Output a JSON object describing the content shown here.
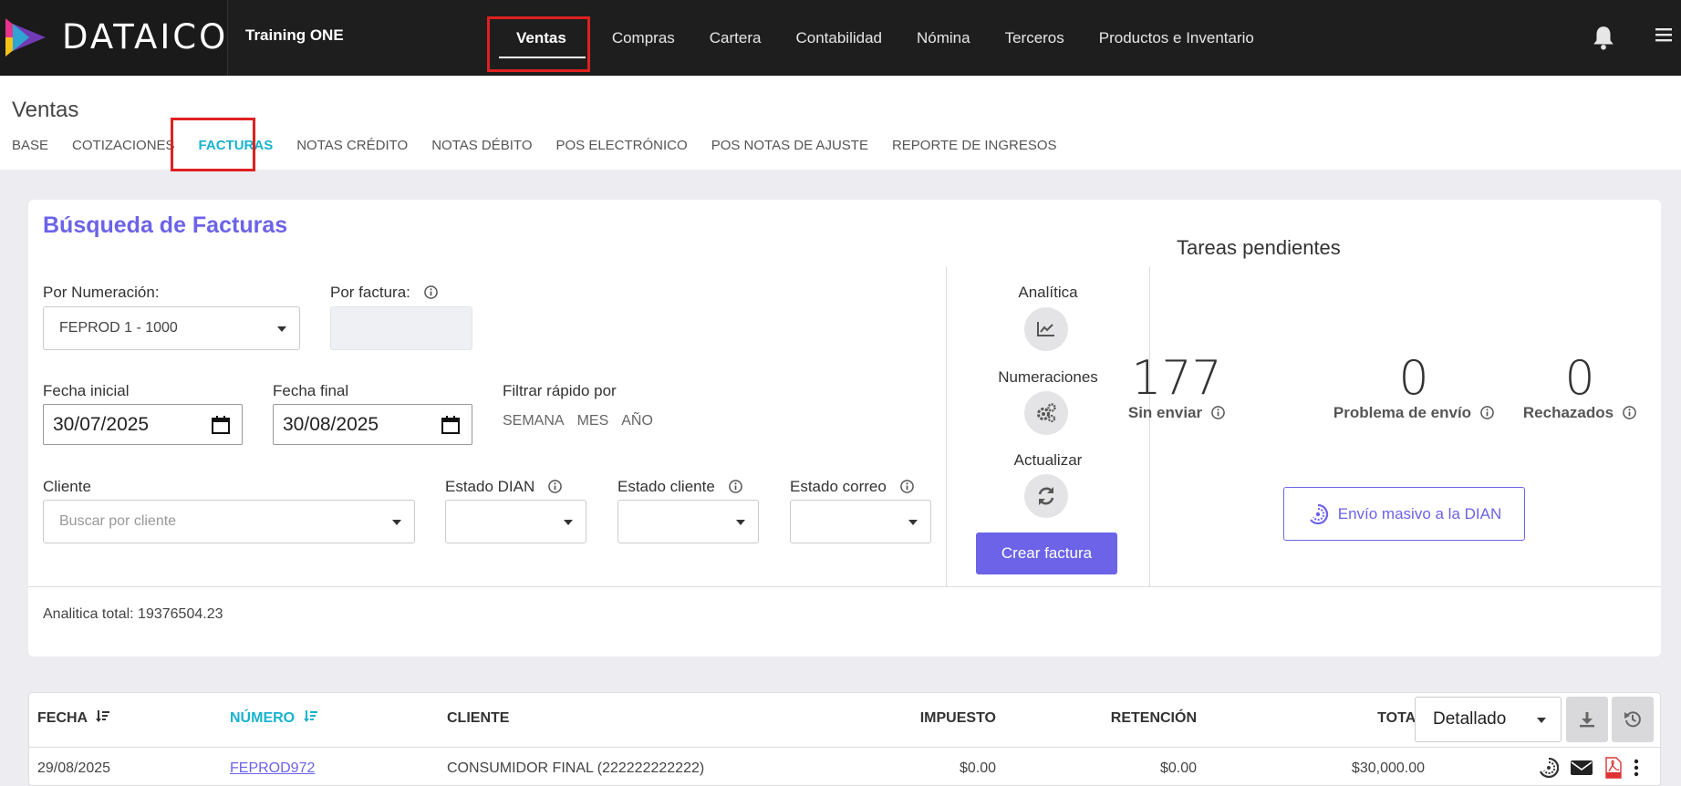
{
  "brand": {
    "name": "DATAICO",
    "company": "Training ONE"
  },
  "mainnav": {
    "items": [
      {
        "label": "Ventas",
        "active": true
      },
      {
        "label": "Compras"
      },
      {
        "label": "Cartera"
      },
      {
        "label": "Contabilidad"
      },
      {
        "label": "Nómina"
      },
      {
        "label": "Terceros"
      },
      {
        "label": "Productos e Inventario"
      }
    ]
  },
  "page": {
    "title": "Ventas",
    "subnav": [
      {
        "label": "BASE"
      },
      {
        "label": "COTIZACIONES"
      },
      {
        "label": "FACTURAS",
        "active": true
      },
      {
        "label": "NOTAS CRÉDITO"
      },
      {
        "label": "NOTAS DÉBITO"
      },
      {
        "label": "POS ELECTRÓNICO"
      },
      {
        "label": "POS NOTAS DE AJUSTE"
      },
      {
        "label": "REPORTE DE INGRESOS"
      }
    ]
  },
  "search": {
    "title": "Búsqueda de Facturas",
    "numeracion_label": "Por Numeración:",
    "numeracion_value": "FEPROD 1 - 1000",
    "factura_label": "Por factura:",
    "fecha_inicial_label": "Fecha inicial",
    "fecha_inicial_value": "30/07/2025",
    "fecha_final_label": "Fecha final",
    "fecha_final_value": "30/08/2025",
    "filtro_label": "Filtrar rápido por",
    "filtro_options": [
      "SEMANA",
      "MES",
      "AÑO"
    ],
    "cliente_label": "Cliente",
    "cliente_placeholder": "Buscar por cliente",
    "estado_dian_label": "Estado DIAN",
    "estado_cliente_label": "Estado cliente",
    "estado_correo_label": "Estado correo",
    "analytics_total": "Analitica total: 19376504.23"
  },
  "actions": {
    "analitica": "Analítica",
    "numeraciones": "Numeraciones",
    "actualizar": "Actualizar",
    "crear_factura": "Crear factura"
  },
  "tareas": {
    "title": "Tareas pendientes",
    "stats": [
      {
        "value": "177",
        "label": "Sin enviar"
      },
      {
        "value": "0",
        "label": "Problema de envío"
      },
      {
        "value": "0",
        "label": "Rechazados"
      }
    ],
    "envio_masivo": "Envío masivo a la DIAN"
  },
  "table": {
    "headers": {
      "fecha": "FECHA",
      "numero": "NÚMERO",
      "cliente": "CLIENTE",
      "impuesto": "IMPUESTO",
      "retencion": "RETENCIÓN",
      "total": "TOTAL"
    },
    "view_select": "Detallado",
    "rows": [
      {
        "fecha": "29/08/2025",
        "numero": "FEPROD972",
        "cliente": "CONSUMIDOR FINAL (222222222222)",
        "impuesto": "$0.00",
        "retencion": "$0.00",
        "total": "$30,000.00"
      }
    ]
  },
  "colors": {
    "accent": "#6c63e8",
    "active_tab": "#17b3cf",
    "topbar": "#1e1e1f",
    "highlight": "#e02020"
  }
}
